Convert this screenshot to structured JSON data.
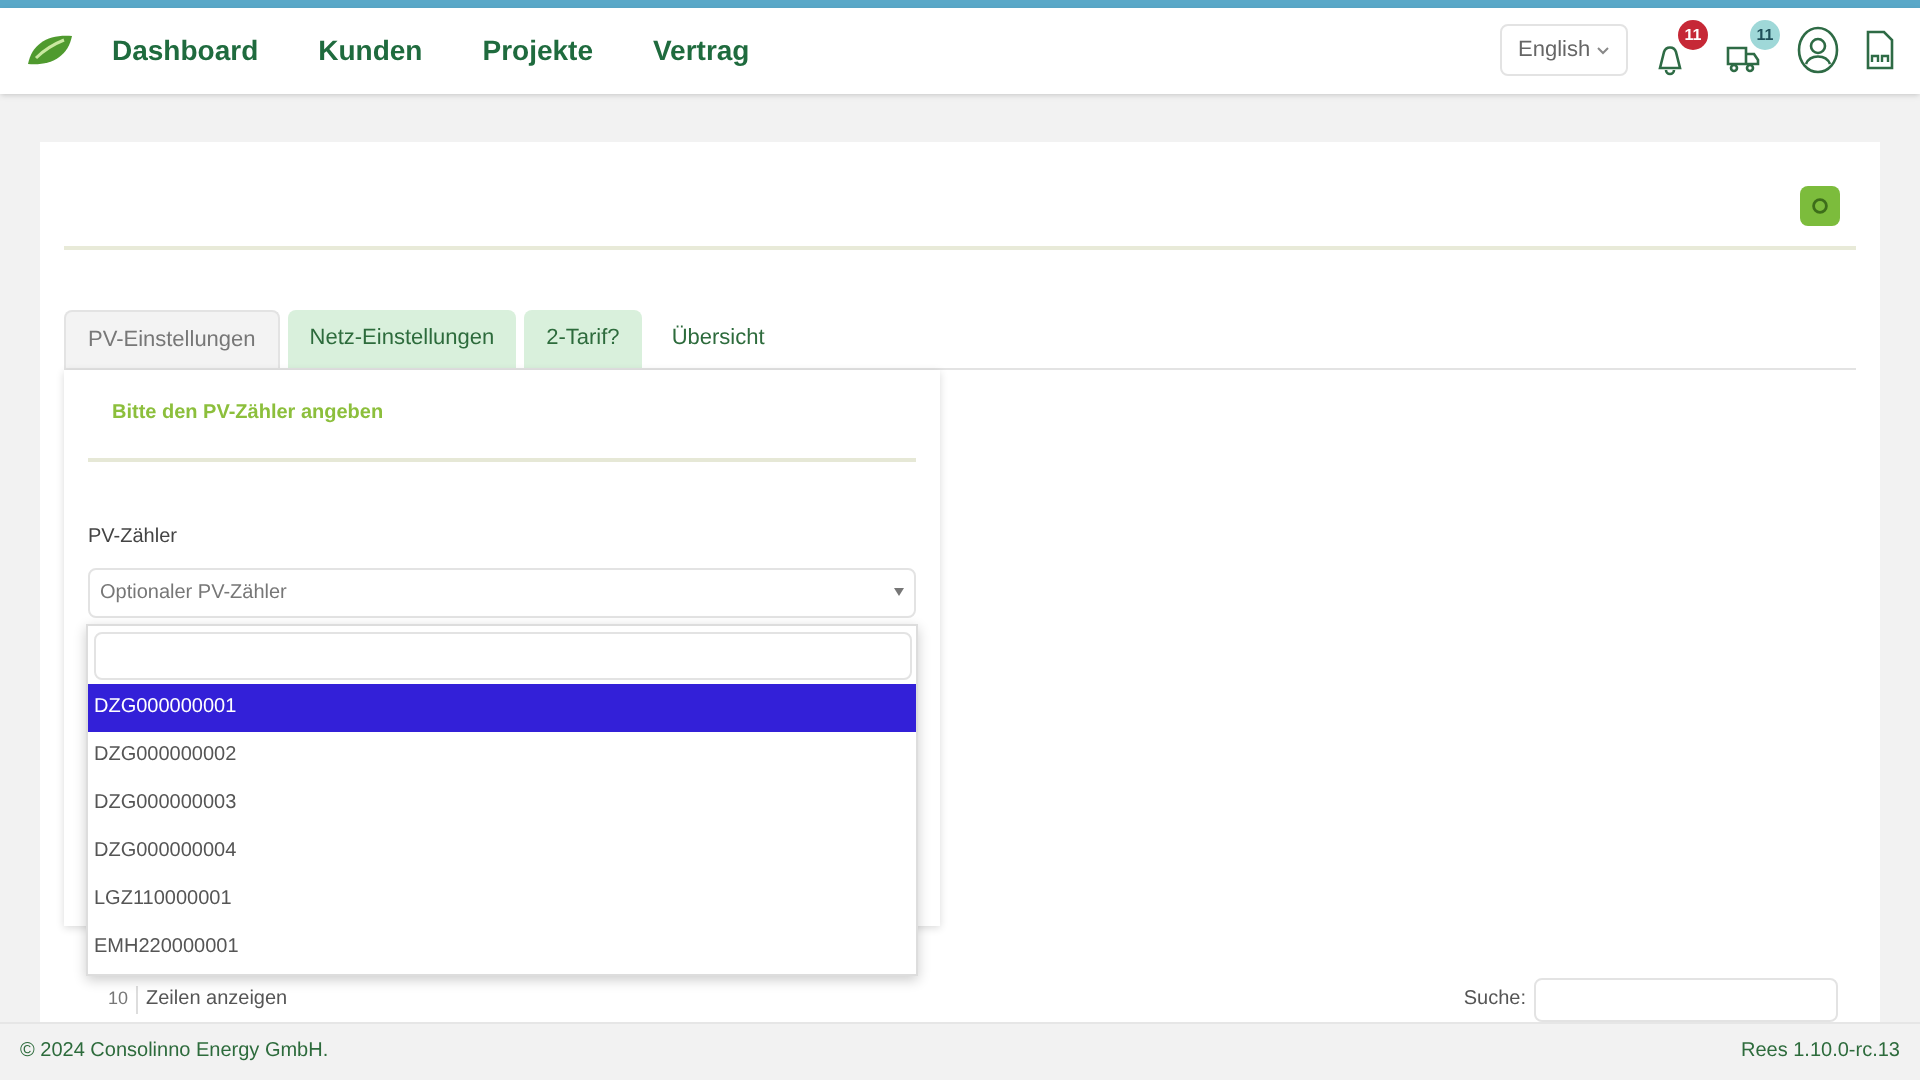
{
  "nav": {
    "items": [
      "Dashboard",
      "Kunden",
      "Projekte",
      "Vertrag"
    ],
    "language": "English",
    "notifications": [
      {
        "count": "11",
        "color": "#c62836"
      },
      {
        "count": "11",
        "color": "#9fd8d8"
      }
    ]
  },
  "tabs": [
    {
      "label": "PV-Einstellungen",
      "selected": true,
      "completed": false
    },
    {
      "label": "Netz-Einstellungen",
      "selected": false,
      "completed": true
    },
    {
      "label": "2-Tarif?",
      "selected": false,
      "completed": true
    },
    {
      "label": "Übersicht",
      "selected": false,
      "completed": false
    }
  ],
  "panel": {
    "heading": "Bitte den PV-Zähler angeben",
    "field_label": "PV-Zähler",
    "select_placeholder": "Optionaler PV-Zähler",
    "dropdown": {
      "options": [
        {
          "label": "DZG000000001",
          "selected": true
        },
        {
          "label": "DZG000000002",
          "selected": false
        },
        {
          "label": "DZG000000003",
          "selected": false
        },
        {
          "label": "DZG000000004",
          "selected": false
        },
        {
          "label": "LGZ110000001",
          "selected": false
        },
        {
          "label": "EMH220000001",
          "selected": false
        }
      ]
    }
  },
  "table_controls": {
    "page_size": "10",
    "page_size_label": "Zeilen anzeigen",
    "search_label": "Suche:"
  },
  "footer": {
    "copyright": "© 2024 Consolinno Energy GmbH.",
    "version": "Rees 1.10.0-rc.13"
  }
}
